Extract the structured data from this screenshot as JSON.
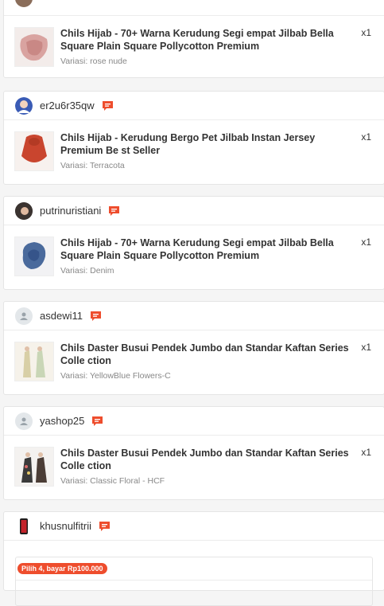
{
  "colors": {
    "accent": "#ee4d2d",
    "background": "#f5f5f5"
  },
  "orders": [
    {
      "username": "",
      "product": "Chils Hijab - 70+ Warna Kerudung Segi empat Jilbab Bella Square Plain Square Pollycotton Premium",
      "variant": "Variasi: rose nude",
      "qty": "x1"
    },
    {
      "username": "er2u6r35qw",
      "avatar": "photo",
      "product": "Chils Hijab - Kerudung Bergo Pet Jilbab Instan Jersey Premium Be st Seller",
      "variant": "Variasi: Terracota",
      "qty": "x1"
    },
    {
      "username": "putrinuristiani",
      "avatar": "photo",
      "product": "Chils Hijab - 70+ Warna Kerudung Segi empat Jilbab Bella Square Plain Square Pollycotton Premium",
      "variant": "Variasi: Denim",
      "qty": "x1"
    },
    {
      "username": "asdewi11",
      "avatar": "default-user-icon",
      "product": "Chils Daster Busui Pendek Jumbo dan Standar Kaftan Series Colle ction",
      "variant": "Variasi: YellowBlue Flowers-C",
      "qty": "x1"
    },
    {
      "username": "yashop25",
      "avatar": "default-user-icon",
      "product": "Chils Daster Busui Pendek Jumbo dan Standar Kaftan Series Colle ction",
      "variant": "Variasi: Classic Floral - HCF",
      "qty": "x1"
    },
    {
      "username": "khusnulfitrii",
      "avatar": "photo",
      "promo_tag": "Pilih 4, bayar Rp100.000"
    }
  ]
}
